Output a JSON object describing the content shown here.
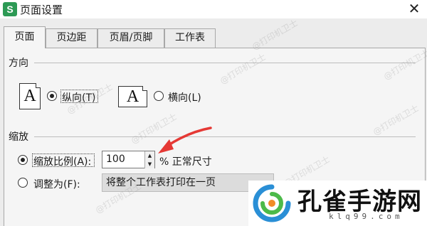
{
  "window": {
    "app_icon": "S",
    "title": "页面设置",
    "close_icon": "close-icon"
  },
  "tabs": [
    {
      "label": "页面",
      "active": true
    },
    {
      "label": "页边距",
      "active": false
    },
    {
      "label": "页眉/页脚",
      "active": false
    },
    {
      "label": "工作表",
      "active": false
    }
  ],
  "orientation": {
    "label": "方向",
    "portrait_glyph": "A",
    "landscape_glyph": "A",
    "portrait_label": "纵向(T)",
    "landscape_label": "横向(L)",
    "selected": "portrait"
  },
  "scaling": {
    "label": "缩放",
    "scale_label": "缩放比例(A):",
    "scale_value": "100",
    "percent_label": "% 正常尺寸",
    "fit_label": "调整为(F):",
    "fit_value": "将整个工作表打印在一页",
    "selected": "scale"
  },
  "watermark": {
    "text": "@打印机卫士"
  },
  "logo": {
    "name": "孔雀手游网",
    "domain": "klq99.com"
  },
  "colors": {
    "arrow": "#e53935",
    "app_icon": "#2d9a55",
    "logo_blue": "#2a8fd6",
    "logo_green": "#4cba4a",
    "logo_orange": "#f28c28"
  }
}
